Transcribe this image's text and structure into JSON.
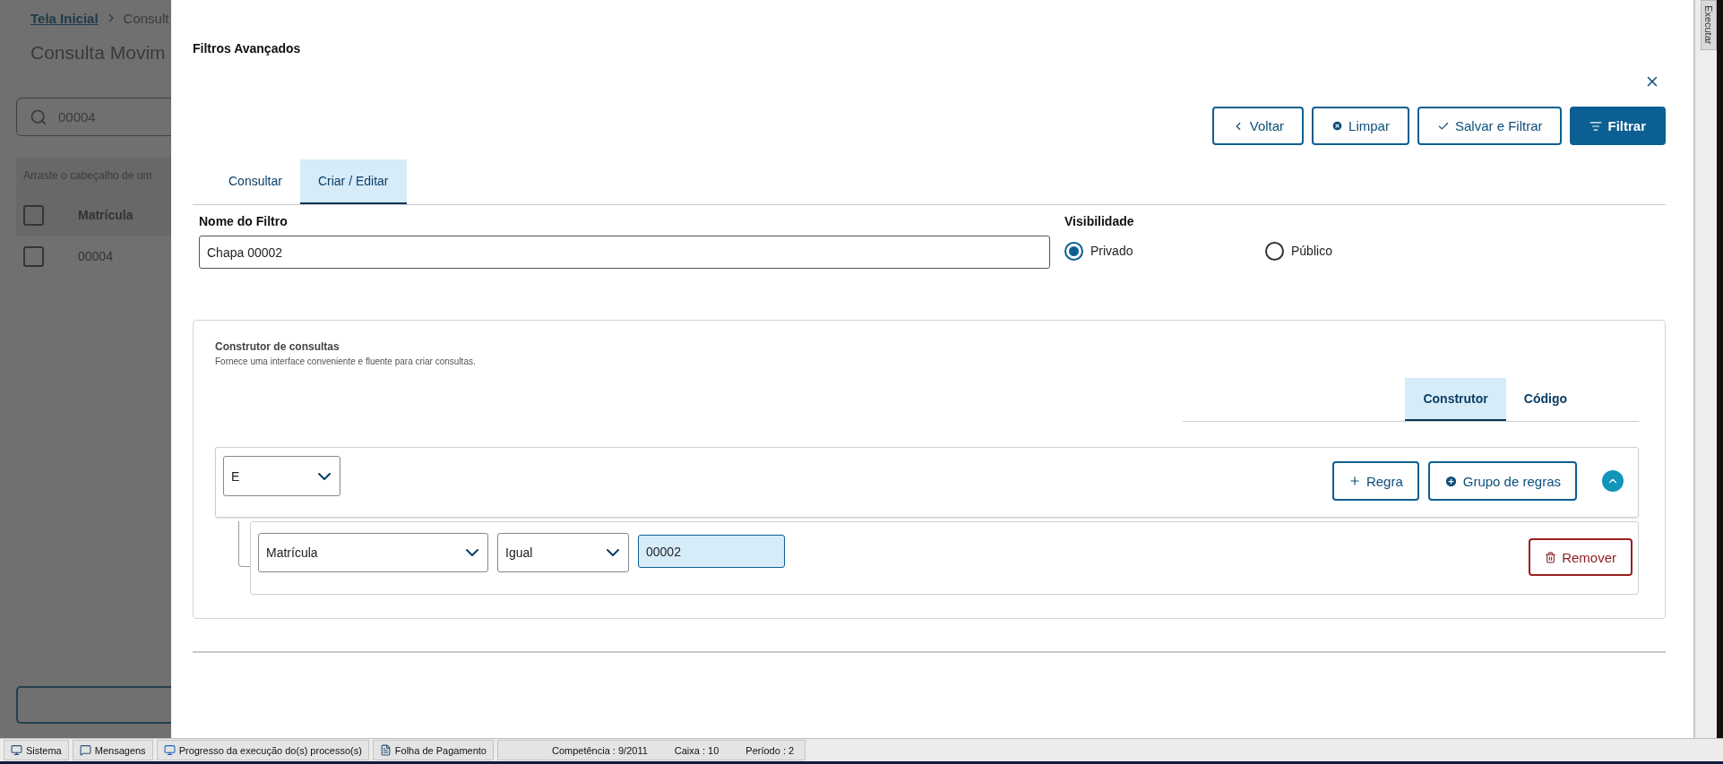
{
  "background_page": {
    "breadcrumb": [
      {
        "label": "Tela Inicial",
        "link": true
      },
      {
        "label": "Consult",
        "link": false
      }
    ],
    "title": "Consulta Movim",
    "search": {
      "value": "00004"
    },
    "group_hint": "Arraste o cabeçalho de um",
    "table": {
      "header_checked": false,
      "columns": [
        "Matrícula"
      ],
      "rows": [
        {
          "checked": false,
          "cells": [
            "00004"
          ]
        }
      ]
    }
  },
  "modal": {
    "title": "Filtros Avançados",
    "actions": [
      {
        "label": "Voltar",
        "kind": "back",
        "primary": false
      },
      {
        "label": "Limpar",
        "kind": "clear",
        "primary": false
      },
      {
        "label": "Salvar e Filtrar",
        "kind": "save",
        "primary": false
      },
      {
        "label": "Filtrar",
        "kind": "filter",
        "primary": true
      }
    ],
    "tabs": [
      {
        "label": "Consultar",
        "selected": false
      },
      {
        "label": "Criar / Editar",
        "selected": true
      }
    ],
    "filter_name": {
      "label": "Nome do Filtro",
      "value": "Chapa 00002"
    },
    "visibility": {
      "label": "Visibilidade",
      "options": [
        {
          "label": "Privado",
          "selected": true
        },
        {
          "label": "Público",
          "selected": false
        }
      ]
    },
    "query_builder": {
      "title": "Construtor de consultas",
      "subtitle": "Fornece uma interface conveniente e fluente para criar consultas.",
      "tabs": [
        {
          "label": "Construtor",
          "selected": true
        },
        {
          "label": "Código",
          "selected": false
        }
      ],
      "group": {
        "operator": "E",
        "expanded": true,
        "buttons": [
          {
            "label": "Regra",
            "kind": "add-rule"
          },
          {
            "label": "Grupo de regras",
            "kind": "add-group"
          }
        ],
        "rules": [
          {
            "field": "Matrícula",
            "operator": "Igual",
            "value": "00002",
            "remove_label": "Remover"
          }
        ]
      }
    }
  },
  "side_tab": {
    "label": "Executar"
  },
  "status_bar": {
    "buttons": [
      {
        "label": "Sistema",
        "kind": "system"
      },
      {
        "label": "Mensagens",
        "kind": "messages"
      },
      {
        "label": "Progresso da execução do(s) processo(s)",
        "kind": "progress"
      },
      {
        "label": "Folha de Pagamento",
        "kind": "payroll"
      }
    ],
    "fields": [
      "Competência : 9/2011",
      "Caixa : 10",
      "Período : 2"
    ]
  }
}
